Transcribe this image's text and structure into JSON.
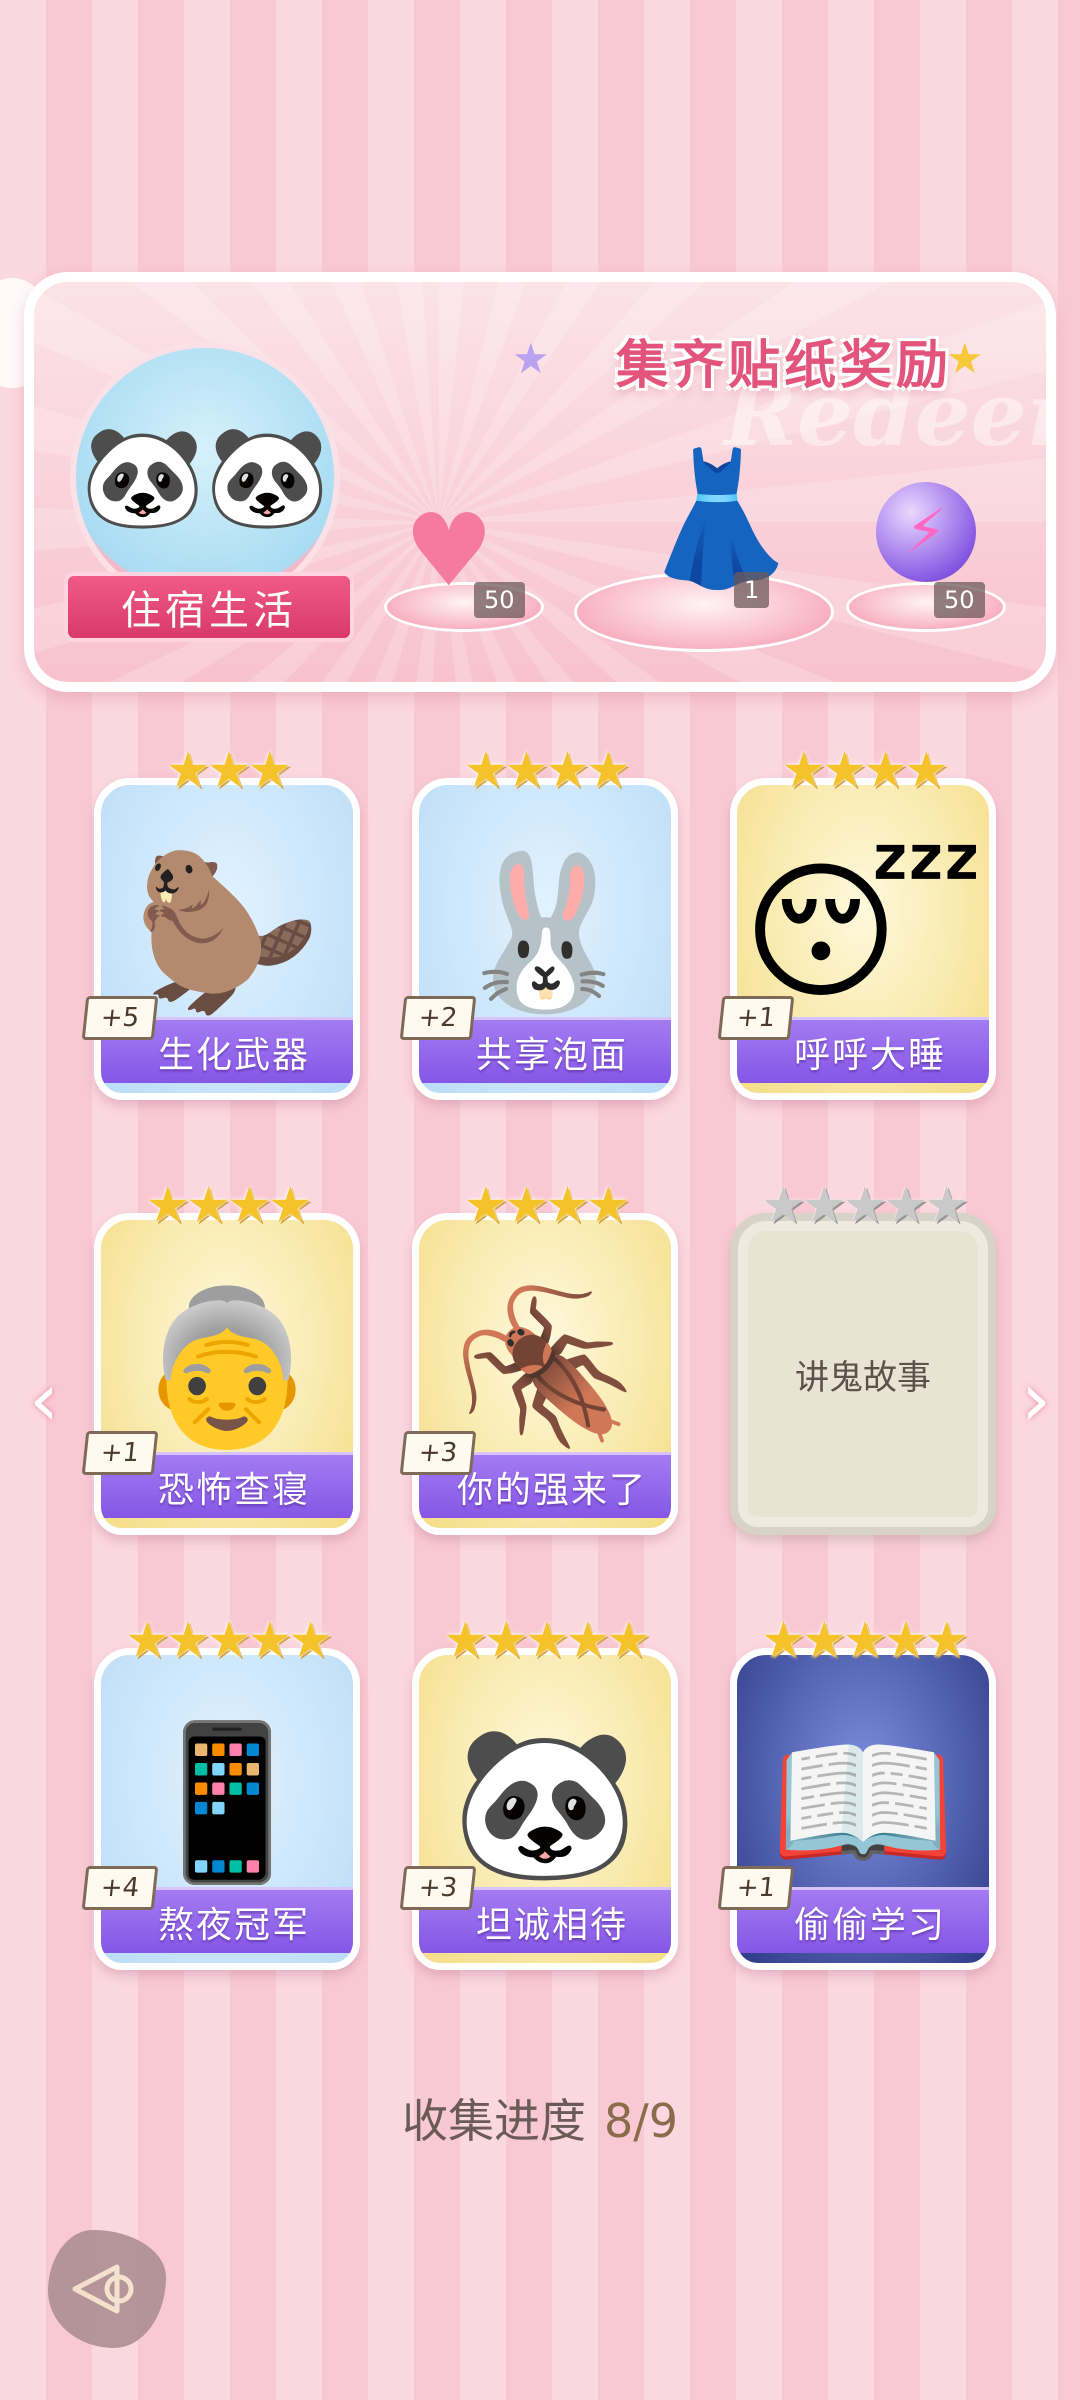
{
  "reward_banner": {
    "title": "集齐贴纸奖励",
    "watermark": "Redeem",
    "theme_name": "住宿生活",
    "rewards": [
      {
        "icon": "pink-heart-gem-icon",
        "count": "50"
      },
      {
        "icon": "dress-outfit-icon",
        "count": "1"
      },
      {
        "icon": "energy-orb-icon",
        "count": "50"
      }
    ]
  },
  "stickers": [
    {
      "name": "生化武器",
      "bonus": "+5",
      "stars": 3,
      "collected": true,
      "icon": "capybara-pajamas-icon",
      "art": "🦫",
      "bg": "blue"
    },
    {
      "name": "共享泡面",
      "bonus": "+2",
      "stars": 4,
      "collected": true,
      "icon": "bunny-noodles-icon",
      "art": "🐰",
      "bg": "blue"
    },
    {
      "name": "呼呼大睡",
      "bonus": "+1",
      "stars": 4,
      "collected": true,
      "icon": "sleeping-boy-icon",
      "art": "😴",
      "bg": "gold"
    },
    {
      "name": "恐怖查寝",
      "bonus": "+1",
      "stars": 4,
      "collected": true,
      "icon": "dorm-aunt-icon",
      "art": "👵",
      "bg": "gold"
    },
    {
      "name": "你的强来了",
      "bonus": "+3",
      "stars": 4,
      "collected": true,
      "icon": "cockroach-icon",
      "art": "🪳",
      "bg": "gold"
    },
    {
      "name": "讲鬼故事",
      "bonus": "",
      "stars": 5,
      "collected": false,
      "icon": "locked-card-icon",
      "art": "",
      "bg": "locked"
    },
    {
      "name": "熬夜冠军",
      "bonus": "+4",
      "stars": 5,
      "collected": true,
      "icon": "boy-phone-bed-icon",
      "art": "📱",
      "bg": "blue"
    },
    {
      "name": "坦诚相待",
      "bonus": "+3",
      "stars": 5,
      "collected": true,
      "icon": "pandas-shower-icon",
      "art": "🐼",
      "bg": "gold"
    },
    {
      "name": "偷偷学习",
      "bonus": "+1",
      "stars": 5,
      "collected": true,
      "icon": "boy-reading-night-icon",
      "art": "📖",
      "bg": "night"
    }
  ],
  "progress": {
    "label": "收集进度",
    "value": "8/9"
  },
  "colors": {
    "accent_pink": "#e2547c",
    "name_band_purple": "#8656e6",
    "star_gold": "#f5c22a"
  }
}
